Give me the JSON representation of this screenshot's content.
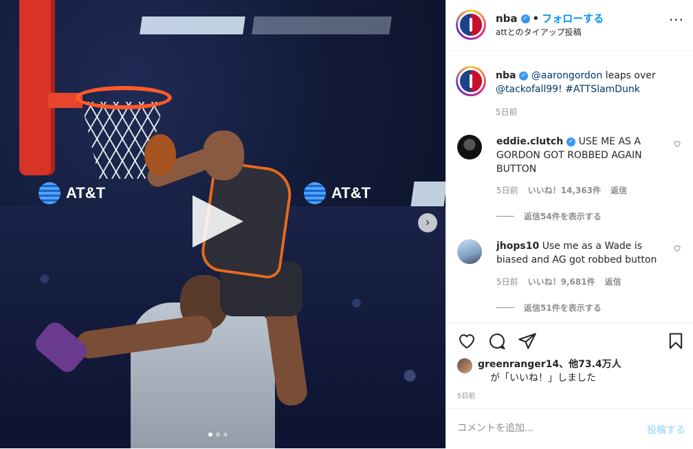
{
  "media": {
    "sponsor_left": "AT&T",
    "sponsor_right": "AT&T",
    "carousel_count": 3,
    "carousel_active_index": 0,
    "next_symbol": "›"
  },
  "header": {
    "username": "nba",
    "verified": "✓",
    "separator": "•",
    "follow_label": "フォローする",
    "subtitle": "attとのタイアップ投稿",
    "more_label": "···"
  },
  "caption": {
    "username": "nba",
    "mention": "@aarongordon",
    "text_middle": " leaps over ",
    "mention2": "@tackofall99",
    "text_end": "! ",
    "hashtag": "#ATTSlamDunk",
    "time": "5日前"
  },
  "comments": [
    {
      "username": "eddie.clutch",
      "text": "USE ME AS A GORDON GOT ROBBED AGAIN BUTTON",
      "time": "5日前",
      "likes": "いいね！14,363件",
      "reply_label": "返信",
      "view_replies": "返信54件を表示する"
    },
    {
      "username": "jhops10",
      "text": "Use me as a Wade is biased and AG got robbed button",
      "time": "5日前",
      "likes": "いいね！9,681件",
      "reply_label": "返信",
      "view_replies": "返信51件を表示する"
    }
  ],
  "actions": {
    "like_icon": "heart-icon",
    "comment_icon": "comment-icon",
    "share_icon": "share-icon",
    "save_icon": "bookmark-icon"
  },
  "likes": {
    "user": "greenranger14",
    "others": "、他73.4万人",
    "line2": "が「いいね！」しました"
  },
  "post_time": "5日前",
  "comment_box": {
    "placeholder": "コメントを追加...",
    "post_label": "投稿する"
  },
  "colors": {
    "accent": "#0095f6",
    "muted": "#8e8e8e",
    "post_disabled": "#b2dffc"
  }
}
